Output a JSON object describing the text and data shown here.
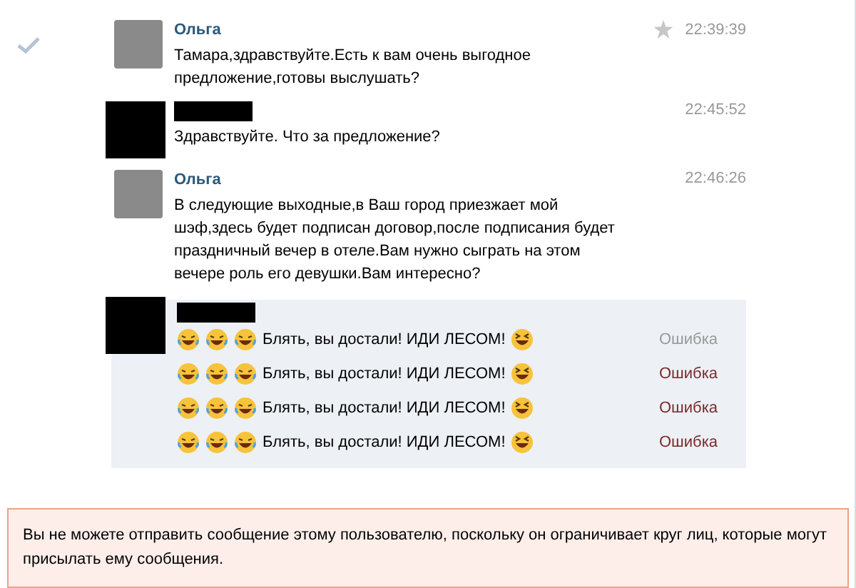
{
  "messages": [
    {
      "author": "Ольга",
      "redacted": false,
      "hovered": true,
      "time": "22:39:39",
      "text": "Тамара,здравствуйте.Есть к вам очень выгодное предложение,готовы выслушать?"
    },
    {
      "redacted": true,
      "hovered": false,
      "time": "22:45:52",
      "text": "Здравствуйте. Что за предложение?"
    },
    {
      "author": "Ольга",
      "redacted": false,
      "hovered": false,
      "time": "22:46:26",
      "text": "В следующие выходные,в Ваш город приезжает мой шэф,здесь будет подписан договор,после подписания будет праздничный вечер в отеле.Вам нужно сыграть на этом вечере роль его девушки.Вам интересно?"
    }
  ],
  "failed_group": {
    "redacted": true,
    "lines": [
      {
        "text": "Блять, вы достали! ИДИ ЛЕСОМ!",
        "status": "Ошибка",
        "color": "#999999"
      },
      {
        "text": "Блять, вы достали! ИДИ ЛЕСОМ!",
        "status": "Ошибка",
        "color": "#7a2a2a"
      },
      {
        "text": "Блять, вы достали! ИДИ ЛЕСОМ!",
        "status": "Ошибка",
        "color": "#7a2a2a"
      },
      {
        "text": "Блять, вы достали! ИДИ ЛЕСОМ!",
        "status": "Ошибка",
        "color": "#7a2a2a"
      }
    ]
  },
  "alert": {
    "text": "Вы не можете отправить сообщение этому пользователю, поскольку он ограничивает круг лиц, которые могут присылать ему сообщения."
  }
}
